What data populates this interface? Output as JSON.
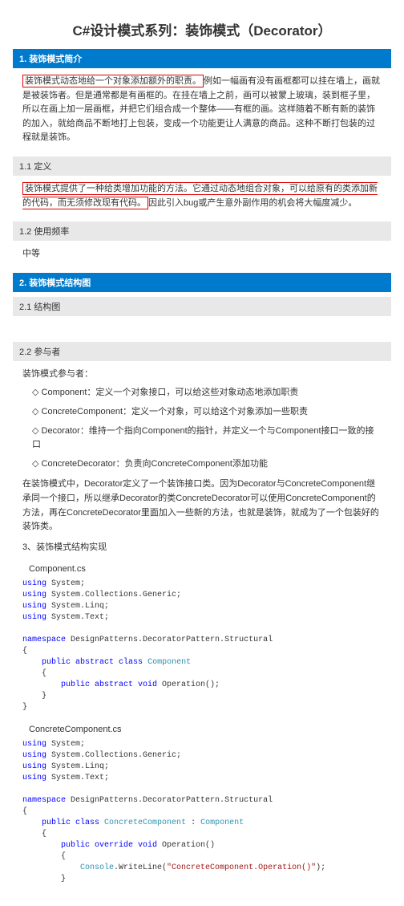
{
  "title": "C#设计模式系列：装饰模式（Decorator）",
  "h1": "1. 装饰模式简介",
  "p1a": "装饰模式动态地给一个对象添加额外的职责。",
  "p1b": "例如一幅画有没有画框都可以挂在墙上，画就是被装饰者。但是通常都是有画框的。在挂在墙上之前，画可以被蒙上玻璃，装到框子里，所以在画上加一层画框，并把它们组合成一个整体——有框的画。这样随着不断有新的装饰的加入，就给商品不断地打上包装，变成一个功能更让人满意的商品。这种不断打包装的过程就是装饰。",
  "h11": "1.1 定义",
  "p11": "装饰模式提供了一种给类增加功能的方法。它通过动态地组合对象，可以给原有的类添加新的代码，而无须修改现有代码。",
  "p11b": "因此引入bug或产生意外副作用的机会将大幅度减少。",
  "h12": "1.2 使用频率",
  "p12": "中等",
  "h2": "2. 装饰模式结构图",
  "h21": "2.1 结构图",
  "h22": "2.2 参与者",
  "p22a": "装饰模式参与者：",
  "item1": "◇ Component：定义一个对象接口，可以给这些对象动态地添加职责",
  "item2": "◇ ConcreteComponent：定义一个对象，可以给这个对象添加一些职责",
  "item3": "◇ Decorator：维持一个指向Component的指针，并定义一个与Component接口一致的接口",
  "item4": "◇ ConcreteDecorator：负责向ConcreteComponent添加功能",
  "p22b": "在装饰模式中，Decorator定义了一个装饰接口类。因为Decorator与ConcreteComponent继承同一个接口，所以继承Decorator的类ConcreteDecorator可以使用ConcreteComponent的方法，再在ConcreteDecorator里面加入一些新的方法，也就是装饰，就成为了一个包装好的装饰类。",
  "h3": "3、装饰模式结构实现",
  "file1": "Component.cs",
  "file2": "ConcreteComponent.cs",
  "ns": "DesignPatterns.DecoratorPattern.Structural",
  "opstr": "\"ConcreteComponent.Operation()\""
}
